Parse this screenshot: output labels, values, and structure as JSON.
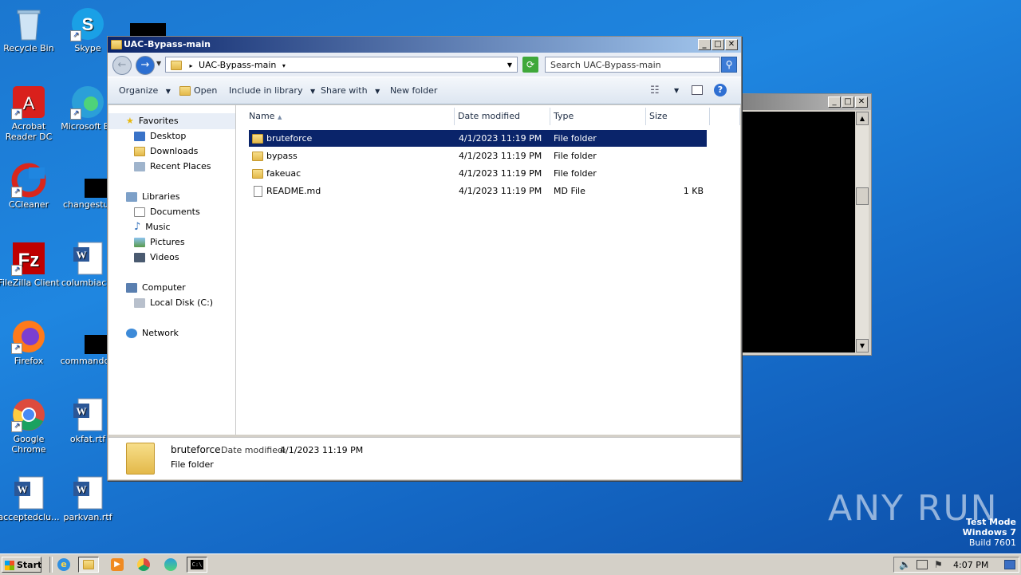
{
  "desktop": {
    "icons": [
      {
        "label": "Recycle Bin"
      },
      {
        "label": "Skype"
      },
      {
        "label": "Acrobat\nReader DC"
      },
      {
        "label": "Microsoft Ed"
      },
      {
        "label": "CCleaner"
      },
      {
        "label": "changestur"
      },
      {
        "label": "FileZilla Client"
      },
      {
        "label": "columbiacal"
      },
      {
        "label": "Firefox"
      },
      {
        "label": "commandqu"
      },
      {
        "label": "Google\nChrome"
      },
      {
        "label": "okfat.rtf"
      },
      {
        "label": "acceptedclu..."
      },
      {
        "label": "parkvan.rtf"
      }
    ],
    "watermark": "ANY RUN",
    "test_mode": {
      "line1": "Test Mode",
      "line2": "Windows 7",
      "line3": "Build 7601"
    }
  },
  "explorer": {
    "title": "UAC-Bypass-main",
    "address": "UAC-Bypass-main",
    "search_placeholder": "Search UAC-Bypass-main",
    "toolbar": {
      "organize": "Organize",
      "open": "Open",
      "include_in_library": "Include in library",
      "share_with": "Share with",
      "new_folder": "New folder"
    },
    "nav": {
      "favorites": "Favorites",
      "desktop": "Desktop",
      "downloads": "Downloads",
      "recent_places": "Recent Places",
      "libraries": "Libraries",
      "documents": "Documents",
      "music": "Music",
      "pictures": "Pictures",
      "videos": "Videos",
      "computer": "Computer",
      "local_disk": "Local Disk (C:)",
      "network": "Network"
    },
    "columns": {
      "name": "Name",
      "date": "Date modified",
      "type": "Type",
      "size": "Size"
    },
    "files": [
      {
        "name": "bruteforce",
        "date": "4/1/2023 11:19 PM",
        "type": "File folder",
        "size": "",
        "kind": "folder",
        "selected": true
      },
      {
        "name": "bypass",
        "date": "4/1/2023 11:19 PM",
        "type": "File folder",
        "size": "",
        "kind": "folder",
        "selected": false
      },
      {
        "name": "fakeuac",
        "date": "4/1/2023 11:19 PM",
        "type": "File folder",
        "size": "",
        "kind": "folder",
        "selected": false
      },
      {
        "name": "README.md",
        "date": "4/1/2023 11:19 PM",
        "type": "MD File",
        "size": "1 KB",
        "kind": "file",
        "selected": false
      }
    ],
    "details": {
      "name": "bruteforce",
      "date_label": "Date modified:",
      "date_value": "4/1/2023 11:19 PM",
      "type": "File folder"
    }
  },
  "taskbar": {
    "start": "Start",
    "clock": "4:07 PM"
  },
  "colors": {
    "selection": "#0a246a",
    "titlebar": "#0a246a"
  }
}
